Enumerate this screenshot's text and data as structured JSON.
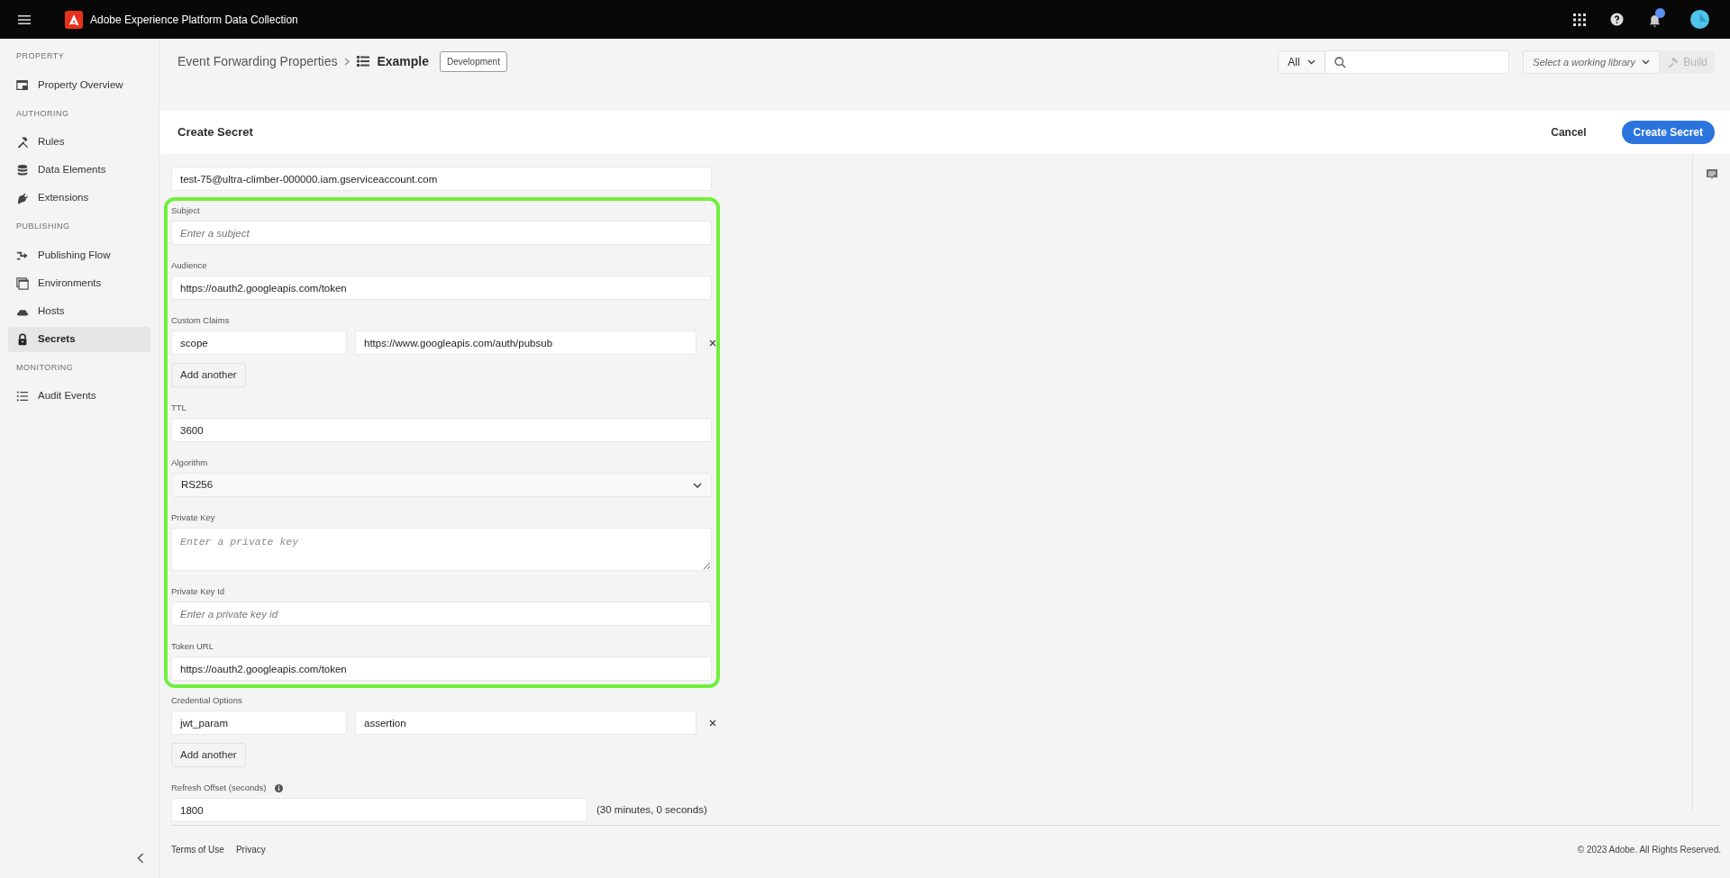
{
  "app": {
    "title": "Adobe Experience Platform Data Collection"
  },
  "sidebar": {
    "sections": [
      {
        "heading": "PROPERTY",
        "items": [
          {
            "label": "Property Overview",
            "selected": false
          }
        ]
      },
      {
        "heading": "AUTHORING",
        "items": [
          {
            "label": "Rules",
            "selected": false
          },
          {
            "label": "Data Elements",
            "selected": false
          },
          {
            "label": "Extensions",
            "selected": false
          }
        ]
      },
      {
        "heading": "PUBLISHING",
        "items": [
          {
            "label": "Publishing Flow",
            "selected": false
          },
          {
            "label": "Environments",
            "selected": false
          },
          {
            "label": "Hosts",
            "selected": false
          },
          {
            "label": "Secrets",
            "selected": true
          }
        ]
      },
      {
        "heading": "MONITORING",
        "items": [
          {
            "label": "Audit Events",
            "selected": false
          }
        ]
      }
    ]
  },
  "breadcrumb": {
    "parent": "Event Forwarding Properties",
    "current": "Example",
    "badge": "Development"
  },
  "search": {
    "scope": "All"
  },
  "library": {
    "placeholder": "Select a working library"
  },
  "build_button": {
    "label": "Build",
    "disabled": true
  },
  "form": {
    "title": "Create Secret",
    "cancel": "Cancel",
    "submit": "Create Secret",
    "groups": [
      {
        "highlighted": false,
        "fields": [
          {
            "kind": "text",
            "value": "test-75@ultra-climber-000000.iam.gserviceaccount.com"
          }
        ]
      },
      {
        "highlighted": true,
        "fields": [
          {
            "kind": "text",
            "label": "Subject",
            "placeholder": "Enter a subject"
          },
          {
            "kind": "text",
            "label": "Audience",
            "value": "https://oauth2.googleapis.com/token"
          },
          {
            "kind": "pairs",
            "label": "Custom Claims",
            "rows": [
              {
                "key": "scope",
                "value": "https://www.googleapis.com/auth/pubsub"
              }
            ],
            "add_label": "Add another"
          },
          {
            "kind": "text",
            "label": "TTL",
            "value": "3600"
          },
          {
            "kind": "select",
            "label": "Algorithm",
            "value": "RS256"
          },
          {
            "kind": "textarea",
            "label": "Private Key",
            "placeholder": "Enter a private key"
          },
          {
            "kind": "text",
            "label": "Private Key Id",
            "placeholder": "Enter a private key id"
          },
          {
            "kind": "text",
            "label": "Token URL",
            "value": "https://oauth2.googleapis.com/token"
          }
        ]
      },
      {
        "highlighted": false,
        "fields": [
          {
            "kind": "pairs",
            "label": "Credential Options",
            "rows": [
              {
                "key": "jwt_param",
                "value": "assertion"
              }
            ],
            "add_label": "Add another"
          },
          {
            "kind": "text",
            "label": "Refresh Offset (seconds)",
            "info": true,
            "value": "1800",
            "note": "(30 minutes, 0 seconds)"
          }
        ]
      }
    ]
  },
  "footer": {
    "links": [
      "Terms of Use",
      "Privacy"
    ],
    "copyright": "© 2023 Adobe. All Rights Reserved."
  }
}
